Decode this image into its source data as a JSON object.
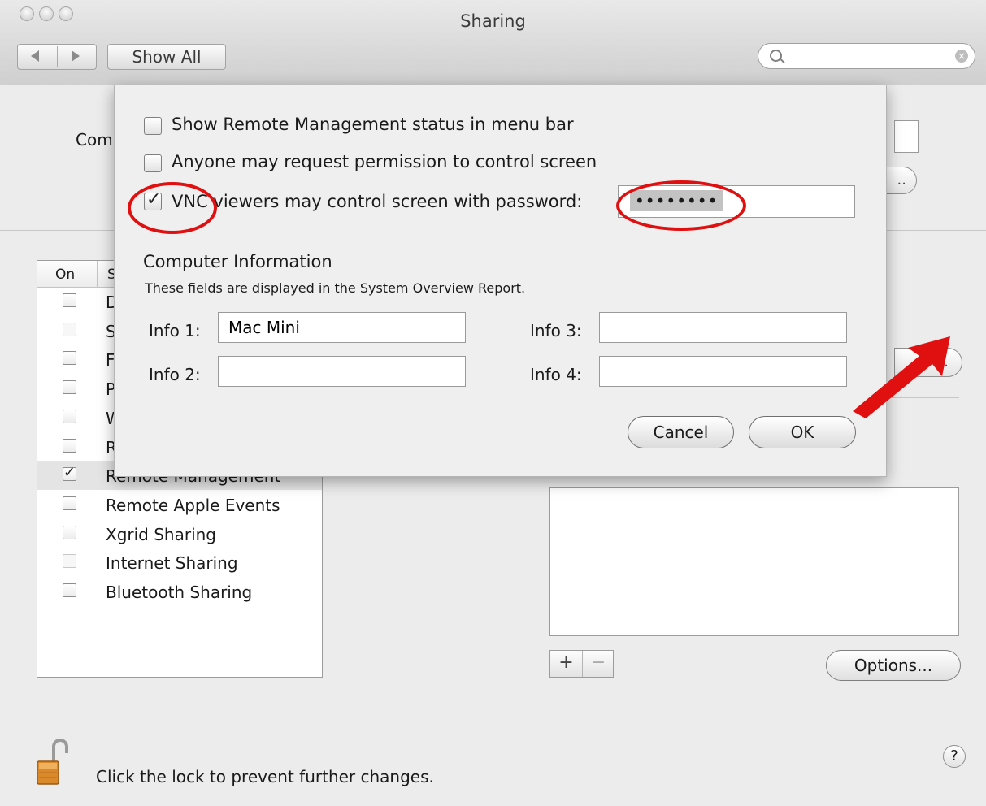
{
  "window": {
    "title": "Sharing"
  },
  "toolbar": {
    "show_all_label": "Show All",
    "search_placeholder": ""
  },
  "background": {
    "computer_name_label_fragment": "Com",
    "list_header_on": "On",
    "list_header_service_fragment": "S",
    "services": [
      {
        "label": "D",
        "checked": false,
        "dim": false
      },
      {
        "label": "S",
        "checked": false,
        "dim": true
      },
      {
        "label": "F",
        "checked": false,
        "dim": false
      },
      {
        "label": "P",
        "checked": false,
        "dim": false
      },
      {
        "label": "W",
        "checked": false,
        "dim": false
      },
      {
        "label": "R",
        "checked": false,
        "dim": false
      },
      {
        "label": "Remote Management",
        "checked": true,
        "dim": false,
        "selected": true
      },
      {
        "label": "Remote Apple Events",
        "checked": false,
        "dim": false
      },
      {
        "label": "Xgrid Sharing",
        "checked": false,
        "dim": false
      },
      {
        "label": "Internet Sharing",
        "checked": false,
        "dim": true
      },
      {
        "label": "Bluetooth Sharing",
        "checked": false,
        "dim": false
      }
    ],
    "edit_button_fragment": "..",
    "computer_settings_fragment": "...",
    "add_label": "+",
    "remove_label": "−",
    "options_label": "Options..."
  },
  "sheet": {
    "options": [
      {
        "label": "Show Remote Management status in menu bar",
        "checked": false
      },
      {
        "label": "Anyone may request permission to control screen",
        "checked": false
      },
      {
        "label": "VNC viewers may control screen with password:",
        "checked": true
      }
    ],
    "password_value": "••••••••",
    "computer_info_title": "Computer Information",
    "computer_info_subtitle": "These fields are displayed in the System Overview Report.",
    "info_fields": [
      {
        "label": "Info 1:",
        "value": "Mac Mini"
      },
      {
        "label": "Info 2:",
        "value": ""
      },
      {
        "label": "Info 3:",
        "value": ""
      },
      {
        "label": "Info 4:",
        "value": ""
      }
    ],
    "cancel_label": "Cancel",
    "ok_label": "OK"
  },
  "footer": {
    "lock_text": "Click the lock to prevent further changes.",
    "help_label": "?"
  },
  "colors": {
    "annotation": "#e01010",
    "window_bg": "#ececec",
    "selection": "#e4e4e4"
  }
}
